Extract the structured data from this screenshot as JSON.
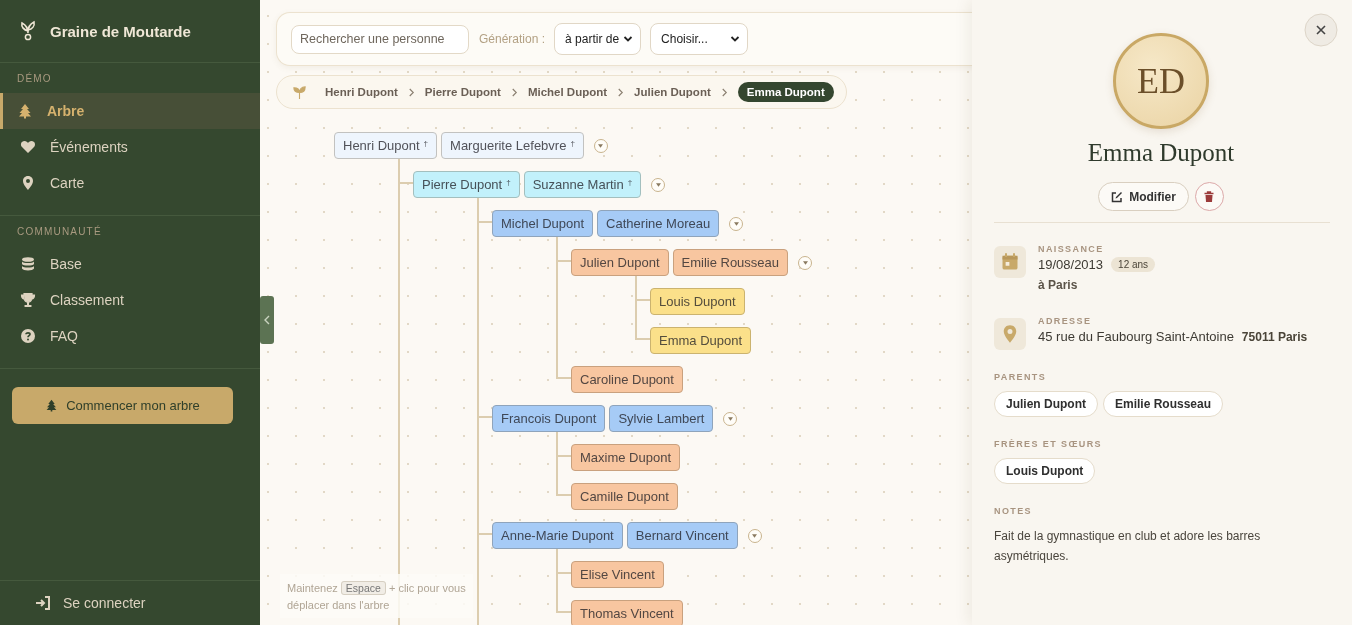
{
  "app": {
    "name": "Graine de Moutarde"
  },
  "sidebar": {
    "sections": [
      {
        "title": "DÉMO",
        "items": [
          {
            "label": "Arbre",
            "selected": true
          },
          {
            "label": "Événements",
            "selected": false
          },
          {
            "label": "Carte",
            "selected": false
          }
        ]
      },
      {
        "title": "COMMUNAUTÉ",
        "items": [
          {
            "label": "Base",
            "selected": false
          },
          {
            "label": "Classement",
            "selected": false
          },
          {
            "label": "FAQ",
            "selected": false
          }
        ]
      }
    ],
    "cta": "Commencer mon arbre",
    "login": "Se connecter"
  },
  "toolbar": {
    "search": {
      "placeholder": "Rechercher une personne"
    },
    "generation_label": "Génération :",
    "generation_mode": "à partir de",
    "generation_value": "Choisir..."
  },
  "breadcrumb": [
    {
      "label": "Henri Dupont",
      "selected": false
    },
    {
      "label": "Pierre Dupont",
      "selected": false
    },
    {
      "label": "Michel Dupont",
      "selected": false
    },
    {
      "label": "Julien Dupont",
      "selected": false
    },
    {
      "label": "Emma Dupont",
      "selected": true
    }
  ],
  "tree": {
    "expanded": true,
    "continues": true,
    "people": [
      {
        "name": "Henri Dupont",
        "mark": "†",
        "color": "#eef5fd"
      },
      {
        "name": "Marguerite Lefebvre",
        "mark": "†",
        "color": "#eef5fd"
      }
    ],
    "children": [
      {
        "expanded": true,
        "continues": true,
        "people": [
          {
            "name": "Pierre Dupont",
            "mark": "†",
            "color": "#c2f1fb"
          },
          {
            "name": "Suzanne Martin",
            "mark": "†",
            "color": "#c2f1fb"
          }
        ],
        "children": [
          {
            "expanded": true,
            "people": [
              {
                "name": "Michel Dupont",
                "color": "#a6cbf6"
              },
              {
                "name": "Catherine Moreau",
                "color": "#a6cbf6"
              }
            ],
            "children": [
              {
                "expanded": true,
                "people": [
                  {
                    "name": "Julien Dupont",
                    "color": "#f8c6a0"
                  },
                  {
                    "name": "Emilie Rousseau",
                    "color": "#f8c6a0"
                  }
                ],
                "children": [
                  {
                    "people": [
                      {
                        "name": "Louis Dupont",
                        "color": "#fbe08a"
                      }
                    ]
                  },
                  {
                    "people": [
                      {
                        "name": "Emma Dupont",
                        "color": "#fbe08a"
                      }
                    ]
                  }
                ]
              },
              {
                "people": [
                  {
                    "name": "Caroline Dupont",
                    "color": "#f8c6a0"
                  }
                ]
              }
            ]
          },
          {
            "expanded": true,
            "people": [
              {
                "name": "Francois Dupont",
                "color": "#a6cbf6"
              },
              {
                "name": "Sylvie Lambert",
                "color": "#a6cbf6"
              }
            ],
            "children": [
              {
                "people": [
                  {
                    "name": "Maxime Dupont",
                    "color": "#f8c6a0"
                  }
                ]
              },
              {
                "people": [
                  {
                    "name": "Camille Dupont",
                    "color": "#f8c6a0"
                  }
                ]
              }
            ]
          },
          {
            "expanded": true,
            "people": [
              {
                "name": "Anne-Marie Dupont",
                "color": "#a6cbf6"
              },
              {
                "name": "Bernard Vincent",
                "color": "#a6cbf6"
              }
            ],
            "children": [
              {
                "people": [
                  {
                    "name": "Elise Vincent",
                    "color": "#f8c6a0"
                  }
                ]
              },
              {
                "people": [
                  {
                    "name": "Thomas Vincent",
                    "color": "#f8c6a0"
                  }
                ]
              }
            ]
          }
        ]
      }
    ]
  },
  "hint": {
    "text_before": "Maintenez",
    "key": "Espace",
    "text_after": "+ clic pour vous déplacer dans l'arbre"
  },
  "panel": {
    "initials": "ED",
    "name": "Emma Dupont",
    "edit_button": "Modifier",
    "details": [
      {
        "kind": "birth",
        "label": "NAISSANCE",
        "value": "19/08/2013",
        "badge": "12 ans",
        "place": "à Paris"
      },
      {
        "kind": "address",
        "label": "ADRESSE",
        "value": "45 rue du Faubourg Saint-Antoine",
        "extra": "75011 Paris"
      }
    ],
    "groups": [
      {
        "title": "PARENTS",
        "chips": [
          "Julien Dupont",
          "Emilie Rousseau"
        ]
      },
      {
        "title": "FRÈRES ET SŒURS",
        "chips": [
          "Louis Dupont"
        ]
      }
    ],
    "notes": {
      "title": "NOTES",
      "text": "Fait de la gymnastique en club et adore les barres asymétriques."
    }
  }
}
